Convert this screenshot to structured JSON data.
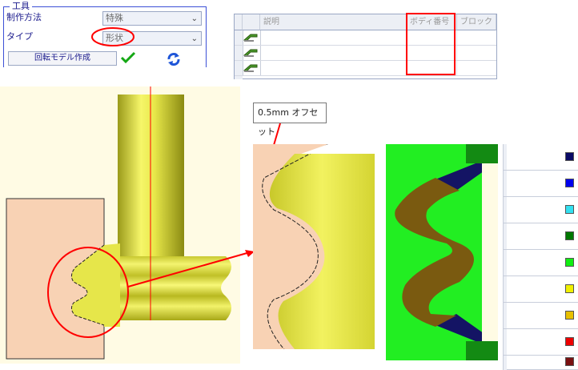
{
  "tool_panel": {
    "title": "工具",
    "row1": {
      "label": "制作方法",
      "value": "特殊"
    },
    "row2": {
      "label": "タイプ",
      "value": "形状"
    },
    "command_label": "回転モデル作成",
    "apply_icon": "check-icon",
    "refresh_icon": "refresh-icon"
  },
  "grid": {
    "headers": [
      "説明",
      "ボディ番号",
      "ブロック"
    ],
    "row_icon": "pencil-shape-icon",
    "row_count": 3
  },
  "annotation": {
    "text": "0.5mm オフセット"
  },
  "palette": {
    "swatches": [
      "#0a0a66",
      "#0000ee",
      "#33e0f0",
      "#007700",
      "#11ee11",
      "#f0f000",
      "#e8c000",
      "#ee0000",
      "#7a1010"
    ]
  },
  "colors": {
    "panel_border": "#3b4fd6",
    "highlight": "#ff0000",
    "viewport_bg": "#fffbe4",
    "part_yellow": "#e6e64a",
    "stock_peach": "#f8d2b4",
    "section_green": "#22ee22",
    "section_brown": "#7a5a10",
    "section_navy": "#141464"
  }
}
